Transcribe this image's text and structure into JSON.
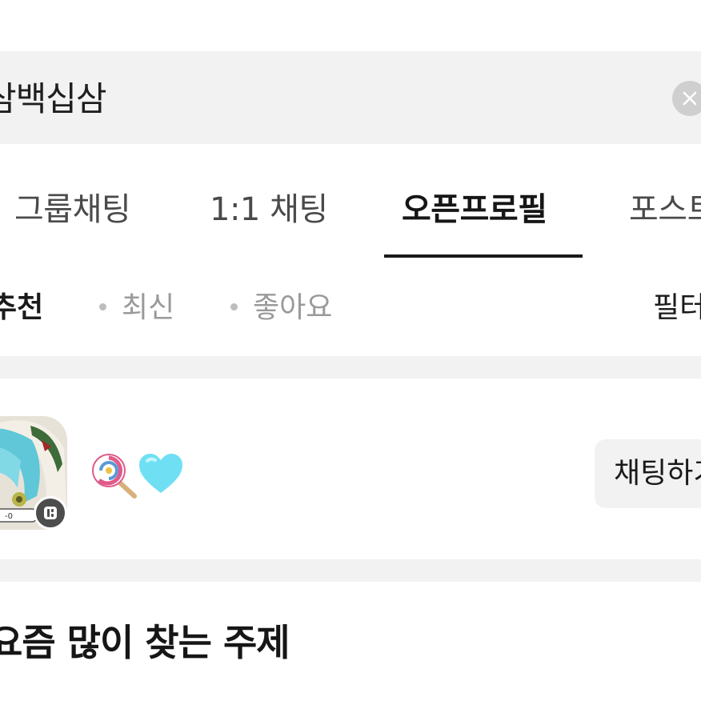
{
  "search": {
    "query": "삼백십삼",
    "clear_icon": "close-icon"
  },
  "tabs": [
    {
      "label": "그룹채팅",
      "active": false
    },
    {
      "label": "1:1 채팅",
      "active": false
    },
    {
      "label": "오픈프로필",
      "active": true
    },
    {
      "label": "포스트",
      "active": false
    }
  ],
  "sort": {
    "options": [
      {
        "label": "추천",
        "active": true
      },
      {
        "label": "최신",
        "active": false
      },
      {
        "label": "좋아요",
        "active": false
      }
    ],
    "filter_label": "필터"
  },
  "profile": {
    "avatar_icon": "profile-avatar",
    "badge_icon": "open-profile-badge-icon",
    "name_emojis": [
      "lollipop-emoji",
      "light-blue-heart-emoji"
    ],
    "chat_button_label": "채팅하기"
  },
  "section": {
    "title": "요즘 많이 찾는 주제"
  },
  "colors": {
    "background": "#ffffff",
    "band": "#f2f2f2",
    "active_text": "#1a1a1a",
    "inactive_text": "#9a9a9a"
  }
}
